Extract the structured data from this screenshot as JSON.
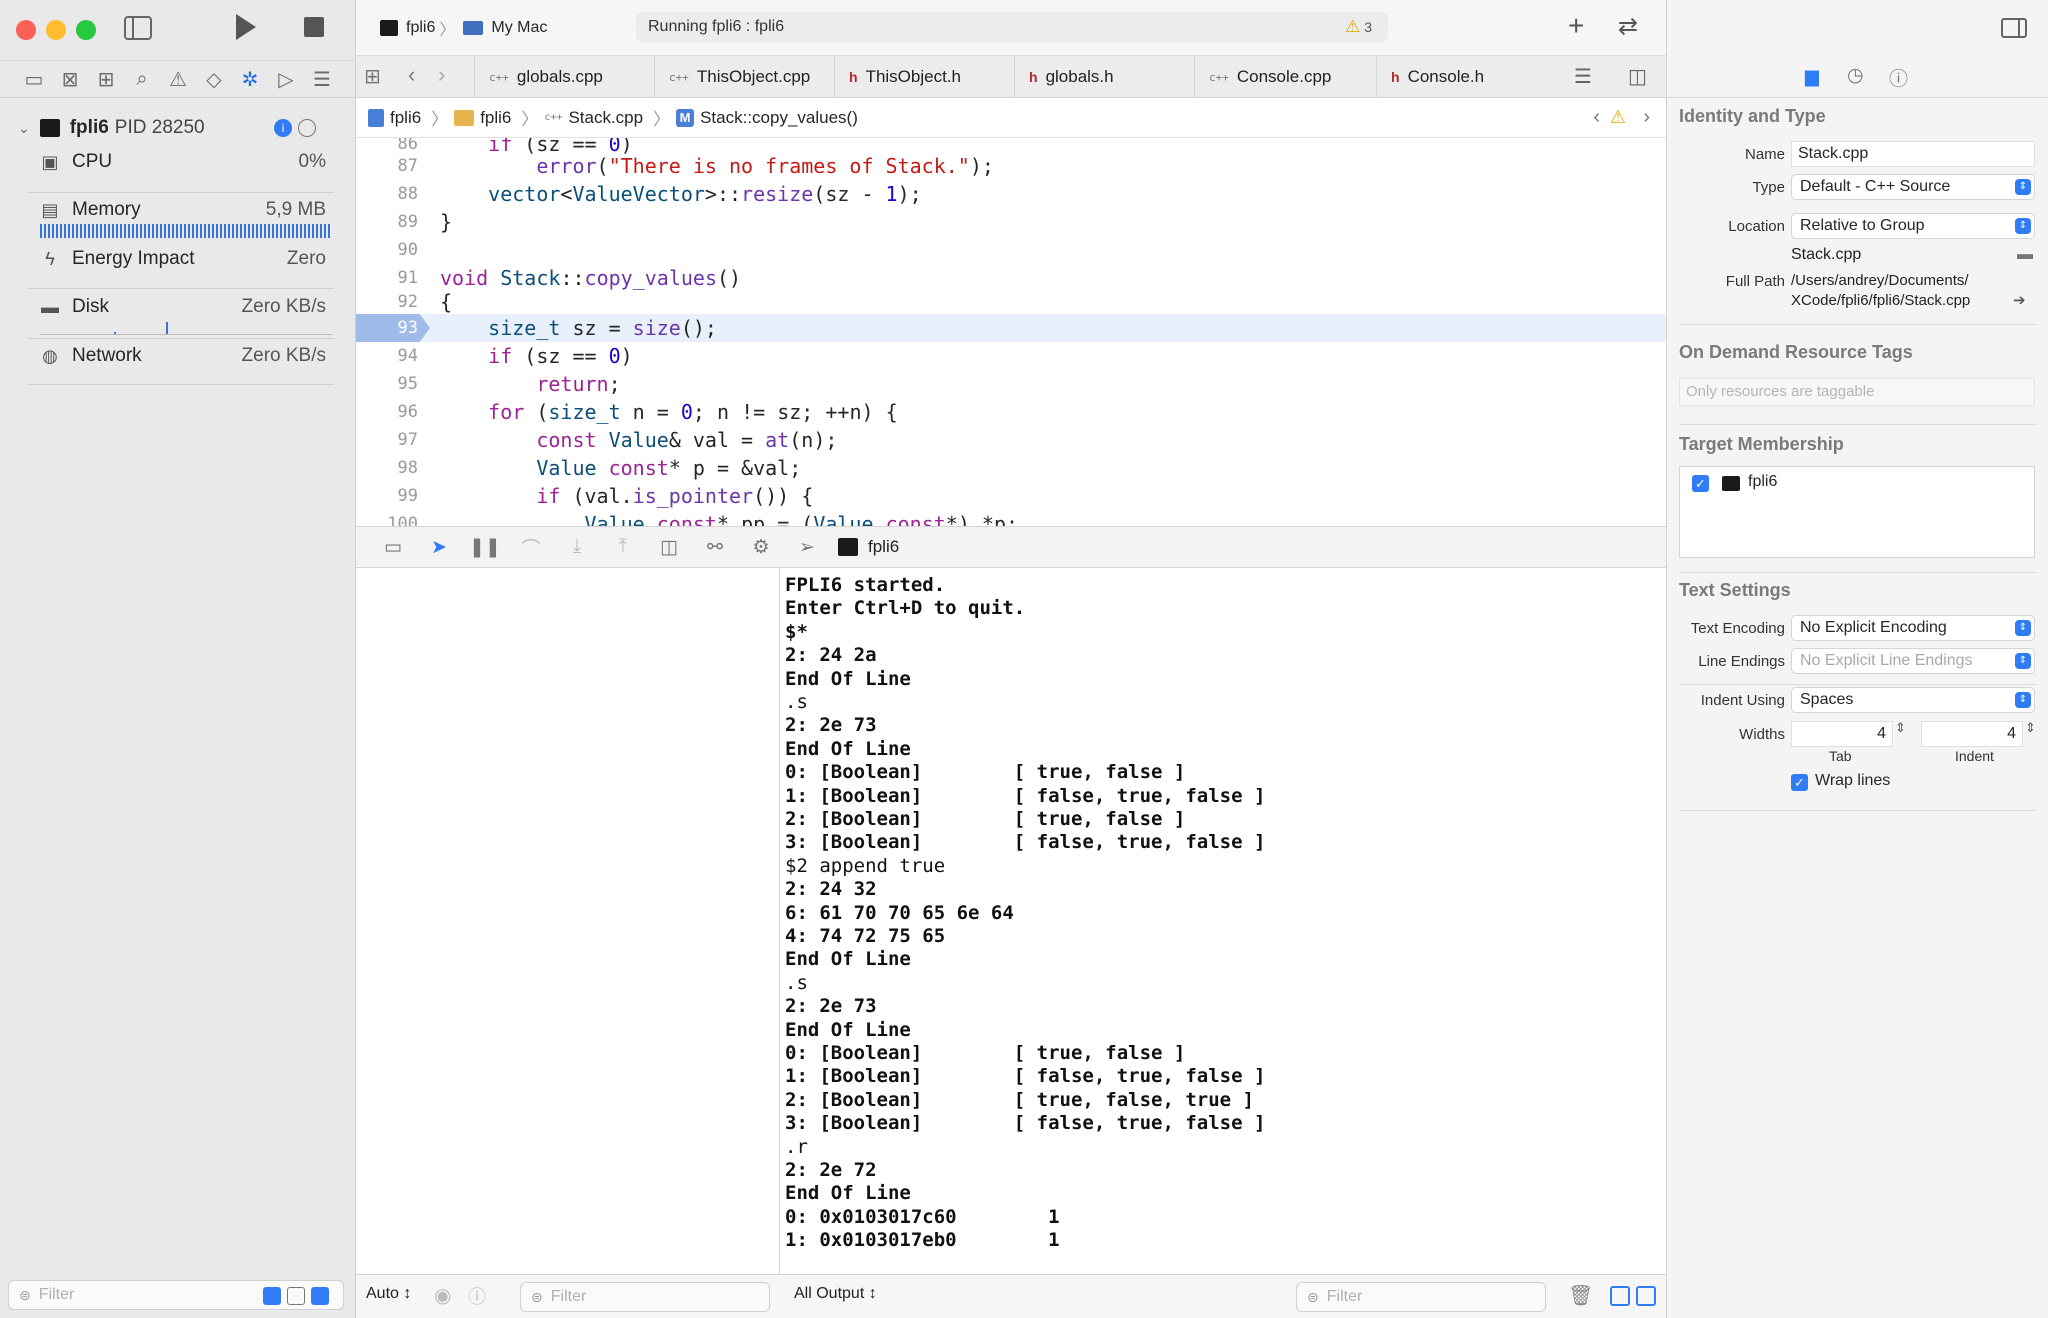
{
  "toolbar": {
    "scheme": "fpli6",
    "destination": "My Mac",
    "status": "Running fpli6 : fpli6",
    "warning_count": "3"
  },
  "navigator": {
    "process_name": "fpli6",
    "process_pid": "PID 28250",
    "gauges": [
      {
        "label": "CPU",
        "value": "0%"
      },
      {
        "label": "Memory",
        "value": "5,9 MB"
      },
      {
        "label": "Energy Impact",
        "value": "Zero"
      },
      {
        "label": "Disk",
        "value": "Zero KB/s"
      },
      {
        "label": "Network",
        "value": "Zero KB/s"
      }
    ],
    "filter_placeholder": "Filter"
  },
  "tabs": [
    {
      "label": "globals.cpp",
      "kind": "cpp"
    },
    {
      "label": "ThisObject.cpp",
      "kind": "cpp"
    },
    {
      "label": "ThisObject.h",
      "kind": "h"
    },
    {
      "label": "globals.h",
      "kind": "h"
    },
    {
      "label": "Console.cpp",
      "kind": "cpp"
    },
    {
      "label": "Console.h",
      "kind": "h"
    }
  ],
  "jumpbar": {
    "project": "fpli6",
    "group": "fpli6",
    "file": "Stack.cpp",
    "symbol": "Stack::copy_values()"
  },
  "code": {
    "current_line": "93",
    "lines": [
      {
        "n": "86",
        "text": "    if (sz == 0)"
      },
      {
        "n": "87",
        "text": "        error(\"There is no frames of Stack.\");"
      },
      {
        "n": "88",
        "text": "    vector<ValueVector>::resize(sz - 1);"
      },
      {
        "n": "89",
        "text": "}"
      },
      {
        "n": "90",
        "text": ""
      },
      {
        "n": "91",
        "text": "void Stack::copy_values()"
      },
      {
        "n": "92",
        "text": "{"
      },
      {
        "n": "93",
        "text": "    size_t sz = size();"
      },
      {
        "n": "94",
        "text": "    if (sz == 0)"
      },
      {
        "n": "95",
        "text": "        return;"
      },
      {
        "n": "96",
        "text": "    for (size_t n = 0; n != sz; ++n) {"
      },
      {
        "n": "97",
        "text": "        const Value& val = at(n);"
      },
      {
        "n": "98",
        "text": "        Value const* p = &val;"
      },
      {
        "n": "99",
        "text": "        if (val.is_pointer()) {"
      },
      {
        "n": "100",
        "text": "            Value const* pp = (Value const*) *p;"
      }
    ]
  },
  "debug_bar": {
    "process_label": "fpli6"
  },
  "console": {
    "lines": [
      {
        "text": "FPLI6 started.",
        "bold": true
      },
      {
        "text": "Enter Ctrl+D to quit.",
        "bold": true
      },
      {
        "text": "$*",
        "bold": true
      },
      {
        "text": "2: 24 2a",
        "bold": true
      },
      {
        "text": "End Of Line",
        "bold": true
      },
      {
        "text": ".s",
        "bold": false
      },
      {
        "text": "2: 2e 73",
        "bold": true
      },
      {
        "text": "End Of Line",
        "bold": true
      },
      {
        "text": "0: [Boolean]        [ true, false ]",
        "bold": true
      },
      {
        "text": "1: [Boolean]        [ false, true, false ]",
        "bold": true
      },
      {
        "text": "2: [Boolean]        [ true, false ]",
        "bold": true
      },
      {
        "text": "3: [Boolean]        [ false, true, false ]",
        "bold": true
      },
      {
        "text": "$2 append true",
        "bold": false
      },
      {
        "text": "2: 24 32",
        "bold": true
      },
      {
        "text": "6: 61 70 70 65 6e 64",
        "bold": true
      },
      {
        "text": "4: 74 72 75 65",
        "bold": true
      },
      {
        "text": "End Of Line",
        "bold": true
      },
      {
        "text": ".s",
        "bold": false
      },
      {
        "text": "2: 2e 73",
        "bold": true
      },
      {
        "text": "End Of Line",
        "bold": true
      },
      {
        "text": "0: [Boolean]        [ true, false ]",
        "bold": true
      },
      {
        "text": "1: [Boolean]        [ false, true, false ]",
        "bold": true
      },
      {
        "text": "2: [Boolean]        [ true, false, true ]",
        "bold": true
      },
      {
        "text": "3: [Boolean]        [ false, true, false ]",
        "bold": true
      },
      {
        "text": ".r",
        "bold": false
      },
      {
        "text": "2: 2e 72",
        "bold": true
      },
      {
        "text": "End Of Line",
        "bold": true
      },
      {
        "text": "0: 0x0103017c60        1",
        "bold": true
      },
      {
        "text": "1: 0x0103017eb0        1",
        "bold": true
      }
    ]
  },
  "bottom": {
    "auto_label": "Auto ↕",
    "vars_filter": "Filter",
    "output_label": "All Output ↕",
    "console_filter": "Filter"
  },
  "inspector": {
    "identity_header": "Identity and Type",
    "name_label": "Name",
    "name_value": "Stack.cpp",
    "type_label": "Type",
    "type_value": "Default - C++ Source",
    "location_label": "Location",
    "location_value": "Relative to Group",
    "location_file": "Stack.cpp",
    "fullpath_label": "Full Path",
    "fullpath_line1": "/Users/andrey/Documents/",
    "fullpath_line2": "XCode/fpli6/fpli6/Stack.cpp",
    "ondemand_header": "On Demand Resource Tags",
    "ondemand_placeholder": "Only resources are taggable",
    "target_header": "Target Membership",
    "target_item": "fpli6",
    "text_header": "Text Settings",
    "encoding_label": "Text Encoding",
    "encoding_value": "No Explicit Encoding",
    "endings_label": "Line Endings",
    "endings_value": "No Explicit Line Endings",
    "indent_label": "Indent Using",
    "indent_value": "Spaces",
    "widths_label": "Widths",
    "tab_width": "4",
    "indent_width": "4",
    "tab_caption": "Tab",
    "indent_caption": "Indent",
    "wrap_label": "Wrap lines"
  },
  "colors": {
    "accent": "#2f7cf6",
    "keyword": "#9b2393",
    "string": "#c41a16",
    "current_line": "#e8f0fb"
  }
}
